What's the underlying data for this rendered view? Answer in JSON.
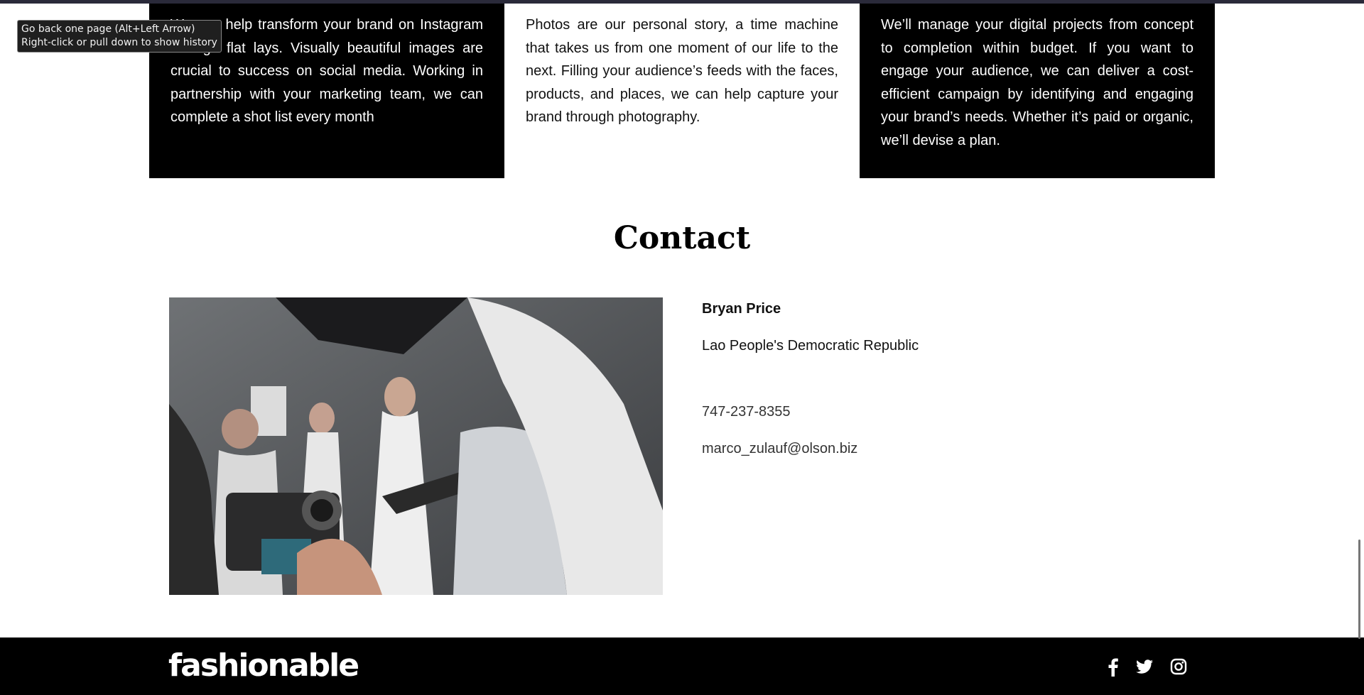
{
  "services": [
    {
      "text": "We can help transform your brand on Instagram through flat lays. Visually beautiful images are crucial to success on social media. Working in partnership with your marketing team, we can complete a shot list every month",
      "theme": "dark"
    },
    {
      "text": "Photos are our personal story, a time machine that takes us from one moment of our life to the next. Filling your audience’s feeds with the faces, products, and places, we can help capture your brand through photography.",
      "theme": "light"
    },
    {
      "text": "We’ll manage your digital projects from concept to completion within budget. If you want to engage your audience, we can deliver a cost-efficient campaign by identifying and engaging your brand’s needs. Whether it’s paid or organic, we’ll devise a plan.",
      "theme": "dark"
    }
  ],
  "contact": {
    "heading": "Contact",
    "name": "Bryan Price",
    "country": "Lao People's Democratic Republic",
    "phone": "747-237-8355",
    "email": "marco_zulauf@olson.biz",
    "photo_icon": "fashion-backstage-photo"
  },
  "footer": {
    "logo": "fashionable",
    "social_icons": [
      "facebook-icon",
      "twitter-icon",
      "instagram-icon"
    ]
  },
  "tooltip": {
    "line1": "Go back one page (Alt+Left Arrow)",
    "line2": "Right-click or pull down to show history"
  },
  "colors": {
    "dark_card": "#000000",
    "footer_bg": "#000000",
    "text_light": "#ffffff"
  }
}
